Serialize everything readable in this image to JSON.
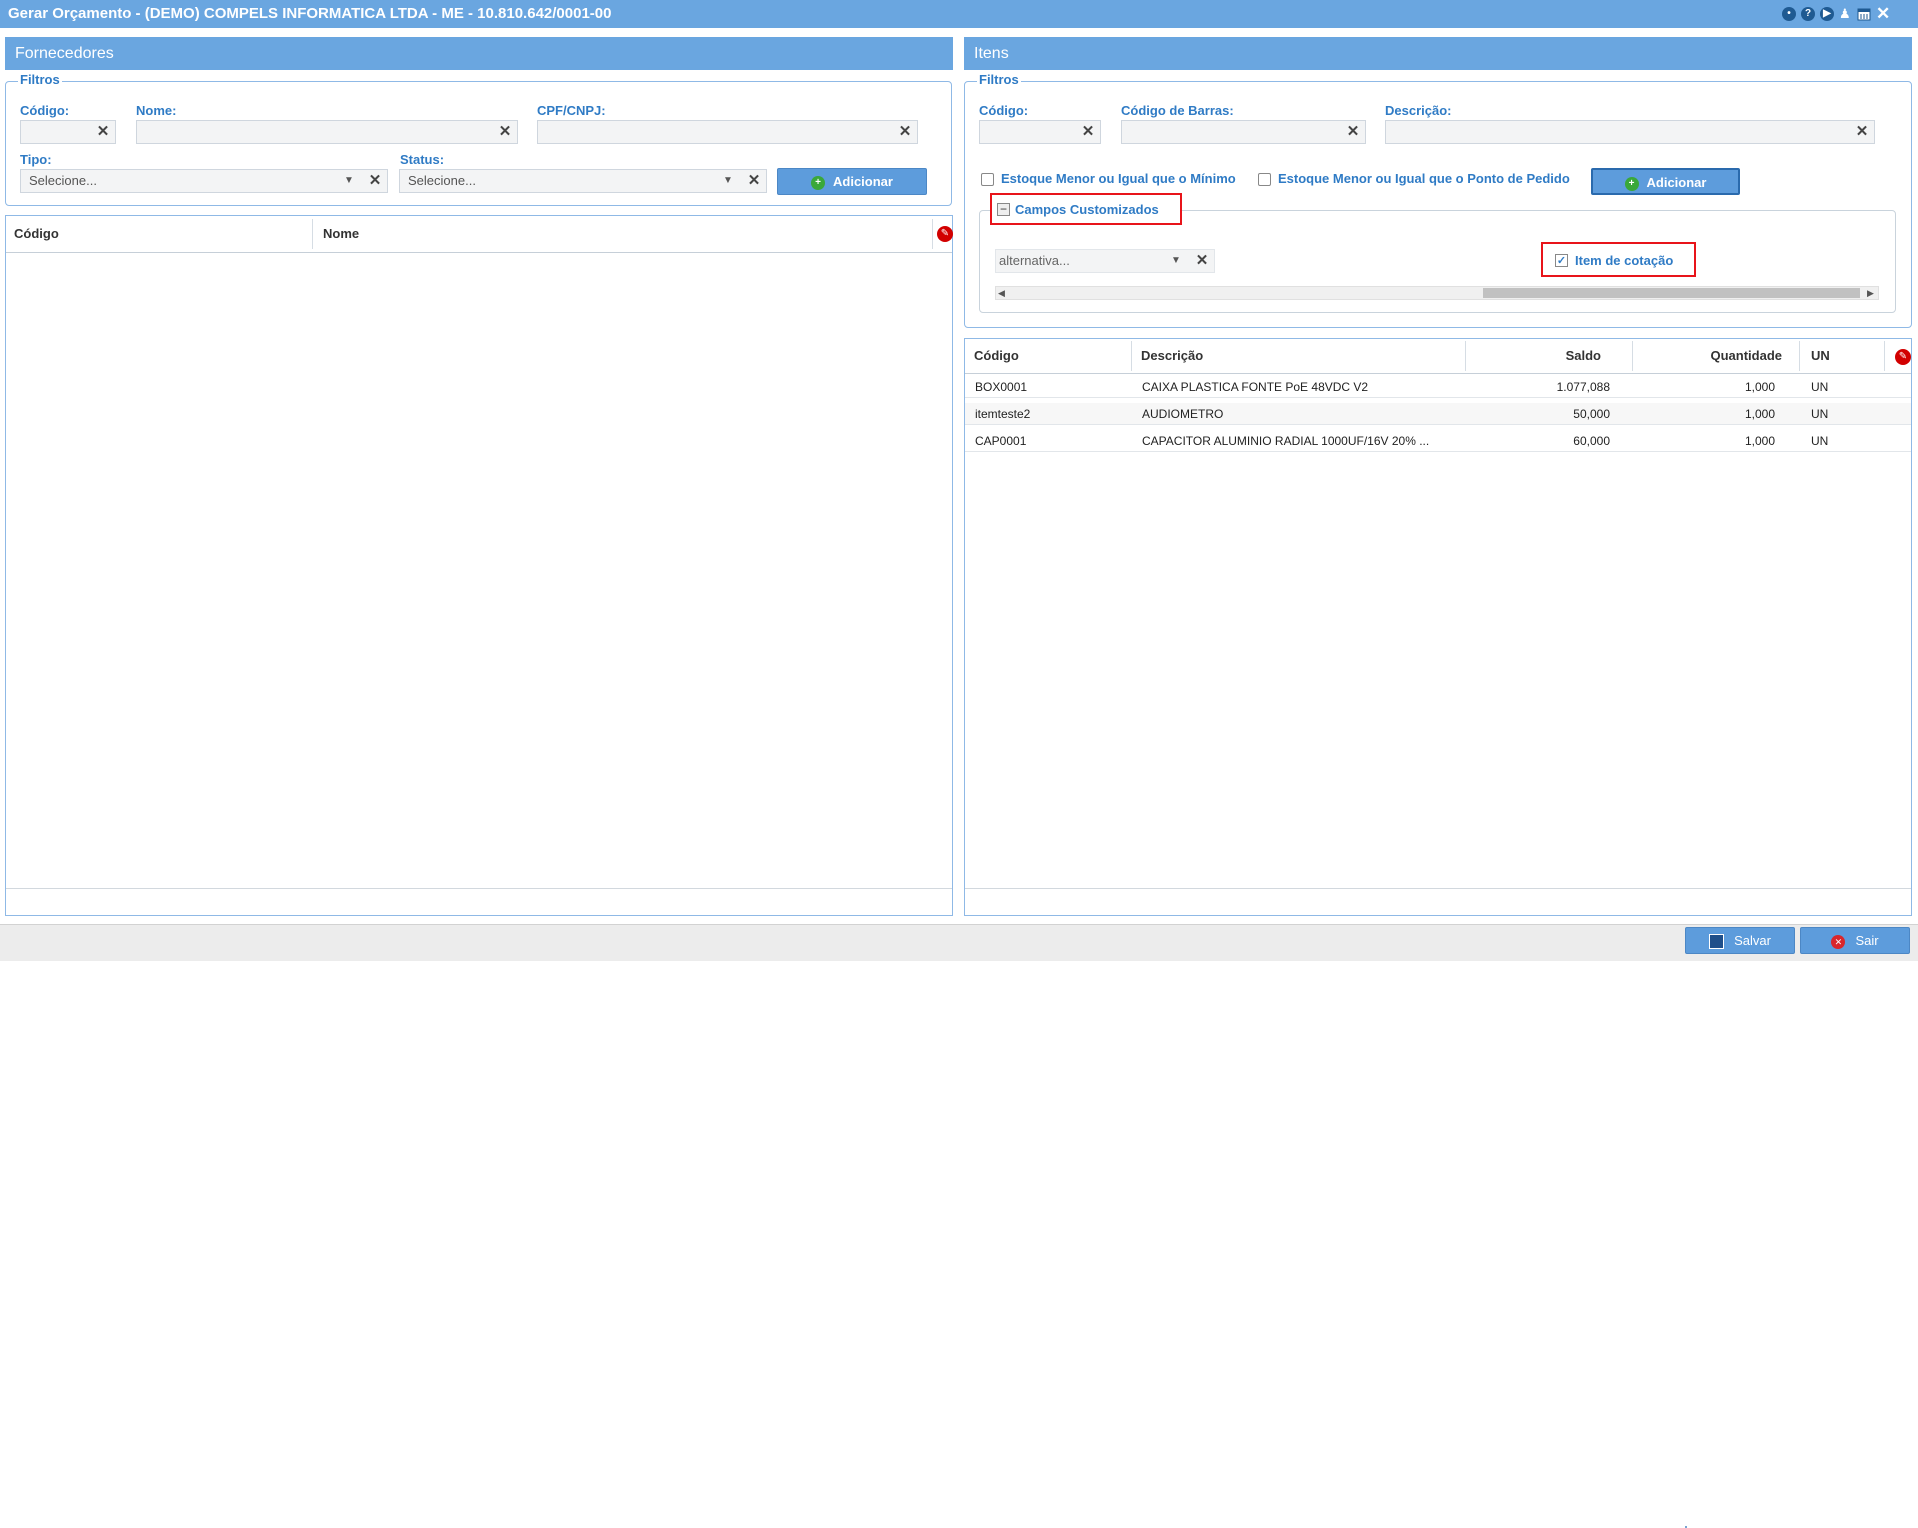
{
  "window": {
    "title": "Gerar Orçamento - (DEMO) COMPELS INFORMATICA LTDA - ME - 10.810.642/0001-00",
    "icons": [
      "circle-icon",
      "help-icon",
      "play-icon",
      "bell-icon",
      "calendar-icon",
      "close-icon"
    ]
  },
  "fornecedores": {
    "title": "Fornecedores",
    "filtros_legend": "Filtros",
    "codigo_label": "Código:",
    "nome_label": "Nome:",
    "cpf_label": "CPF/CNPJ:",
    "tipo_label": "Tipo:",
    "status_label": "Status:",
    "tipo_placeholder": "Selecione...",
    "status_placeholder": "Selecione...",
    "add_button": "Adicionar",
    "columns": [
      "Código",
      "Nome"
    ]
  },
  "itens": {
    "title": "Itens",
    "filtros_legend": "Filtros",
    "codigo_label": "Código:",
    "barras_label": "Código de Barras:",
    "descricao_label": "Descrição:",
    "check_minimo": "Estoque Menor ou Igual que o Mínimo",
    "check_pedido": "Estoque Menor ou Igual que o Ponto de Pedido",
    "add_button": "Adicionar",
    "campos_legend": "Campos Customizados",
    "alternativa_placeholder": "alternativa...",
    "item_cotacao": "Item de cotação",
    "columns": [
      "Código",
      "Descrição",
      "Saldo",
      "Quantidade",
      "UN"
    ],
    "rows": [
      {
        "codigo": "BOX0001",
        "descricao": "CAIXA PLASTICA FONTE PoE 48VDC V2",
        "saldo": "1.077,088",
        "quantidade": "1,000",
        "un": "UN"
      },
      {
        "codigo": "itemteste2",
        "descricao": "AUDIOMETRO",
        "saldo": "50,000",
        "quantidade": "1,000",
        "un": "UN"
      },
      {
        "codigo": "CAP0001",
        "descricao": "CAPACITOR ALUMINIO RADIAL 1000UF/16V 20% ...",
        "saldo": "60,000",
        "quantidade": "1,000",
        "un": "UN"
      }
    ]
  },
  "footer": {
    "save_button": "Salvar",
    "exit_button": "Sair"
  },
  "colors": {
    "header_blue": "#6aa6e0",
    "label_blue": "#2f7bc5",
    "highlight_red": "#e8141a"
  }
}
